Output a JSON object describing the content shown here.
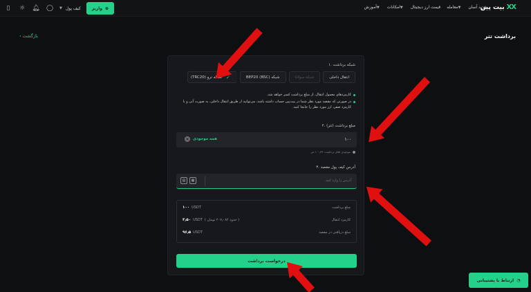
{
  "header": {
    "logo_text": "بیت پین",
    "logo_mark": "XX",
    "nav": [
      "خرید آسان",
      "معامله",
      "قیمت ارز دیجیتال",
      "امکانات",
      "آموزش"
    ],
    "wallet_label": "کیف پول",
    "deposit_label": "واریز"
  },
  "page": {
    "title": "برداشت تتر",
    "back_label": "بازگشت"
  },
  "form": {
    "network_label": "۱. شبکه برداشت",
    "tabs": [
      {
        "label": "انتقال داخلی",
        "state": "normal"
      },
      {
        "label": "شبکه سولانا",
        "state": "disabled"
      },
      {
        "label": "BEP20 (BSC) شبکه",
        "state": "normal"
      },
      {
        "label": "(TRC20) شبکه ترو",
        "state": "active"
      }
    ],
    "notes": [
      "کارمزدهای معمول انتقال، از مبلغ برداشت کسر خواهد شد.",
      "در صورتی که مقصد مورد نظر شما در بیت‌پین حساب داشته باشد، می‌توانید از طریق انتقال داخلی، به صورت آنی و با کارمزد صفر، ارز مورد نظر را جابجا کنید."
    ],
    "amount_label": "۲. مبلغ برداشت (تتر)",
    "amount_value": "۱۰۰",
    "all_balance_label": "همه موجودی",
    "available_text": "موجودی قابل برداشت: ۱۰۰٫۳۹ تتر",
    "address_label": "۳. آدرس کیف پول مقصد",
    "address_placeholder": "آدرس را وارد کنید",
    "summary": [
      {
        "label": "مبلغ برداشت",
        "value": "۱۰۰",
        "unit": "USDT",
        "note": ""
      },
      {
        "label": "کارمزد انتقال",
        "value": "۳٫۵۰",
        "unit": "USDT",
        "note": "( حدود ۲۰۷٫۰۸۲ تومان )"
      },
      {
        "label": "مبلغ دریافتی در مقصد",
        "value": "۹۶٫۵",
        "unit": "USDT",
        "note": ""
      }
    ],
    "submit_label": "درخواست برداشت"
  },
  "support": {
    "label": "ارتباط با پشتیبانی"
  },
  "colors": {
    "accent": "#23d18b",
    "background": "#0e0f11",
    "card": "#17181b",
    "annotation_arrow": "#e01010"
  },
  "icons": [
    "search-icon",
    "bell-icon",
    "user-icon",
    "sun-icon",
    "download-icon",
    "chat-icon",
    "check-icon",
    "paste-icon",
    "qr-icon"
  ]
}
